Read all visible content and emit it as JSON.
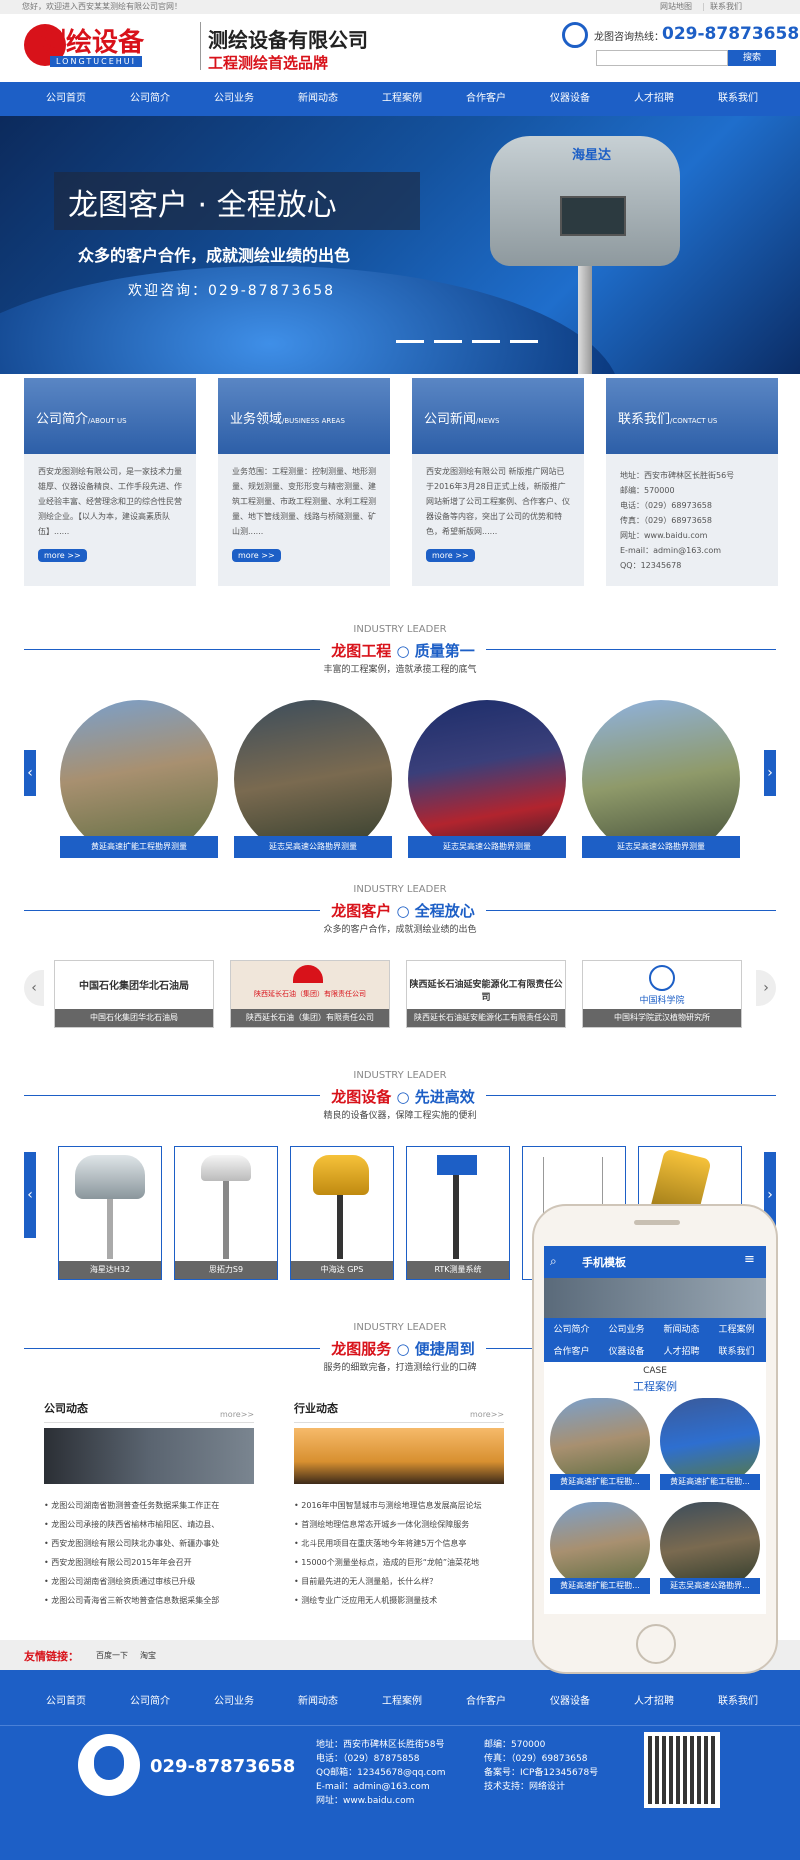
{
  "topbar": {
    "welcome": "您好，欢迎进入西安某某测绘有限公司官网！",
    "links": [
      "网站地图",
      "联系我们"
    ]
  },
  "header": {
    "logo_text": "测绘设备",
    "logo_sub": "LONGTUCEHUI",
    "company": "测绘设备有限公司",
    "slogan": "工程测绘首选品牌",
    "hotline_label": "龙图咨询热线：",
    "hotline": "029-87873658",
    "search_placeholder": "",
    "search_button": "搜索"
  },
  "nav": [
    "公司首页",
    "公司简介",
    "公司业务",
    "新闻动态",
    "工程案例",
    "合作客户",
    "仪器设备",
    "人才招聘",
    "联系我们"
  ],
  "banner": {
    "headline": "龙图客户 · 全程放心",
    "sub": "众多的客户合作，成就测绘业绩的出色",
    "consult": "欢迎咨询：029-87873658",
    "device_brand": "海星达"
  },
  "cards": [
    {
      "title": "公司简介",
      "en": "/ABOUT US",
      "text": "西安龙图测绘有限公司，是一家技术力量雄厚、仪器设备精良、工作手段先进、作业经验丰富、经营理念和卫的综合性民营测绘企业。【以人为本，建设高素质队伍】......",
      "more": "more >>"
    },
    {
      "title": "业务领域",
      "en": "/BUSINESS AREAS",
      "text": "业务范围：工程测量：控制测量、地形测量、规划测量、变形形变与精密测量、建筑工程测量、市政工程测量、水利工程测量、地下管线测量、线路与桥隧测量、矿山测......",
      "more": "more >>"
    },
    {
      "title": "公司新闻",
      "en": "/NEWS",
      "text": "西安龙图测绘有限公司 新版推广网站已于2016年3月28日正式上线，新版推广网站新增了公司工程案例、合作客户、仪器设备等内容，突出了公司的优势和特色，希望新版网......",
      "more": "more >>"
    },
    {
      "title": "联系我们",
      "en": "/CONTACT US",
      "lines": [
        "地址：西安市碑林区长胜街56号",
        "邮编：570000",
        "电话：（029）68973658",
        "传真：（029）68973658",
        "网址：www.baidu.com",
        "E-mail：admin@163.com",
        "QQ：12345678"
      ]
    }
  ],
  "sections": [
    {
      "en": "INDUSTRY LEADER",
      "title_a": "龙图工程",
      "title_b": "质量第一",
      "sub": "丰富的工程案例，造就承揽工程的底气"
    },
    {
      "en": "INDUSTRY LEADER",
      "title_a": "龙图客户",
      "title_b": "全程放心",
      "sub": "众多的客户合作，成就测绘业绩的出色"
    },
    {
      "en": "INDUSTRY LEADER",
      "title_a": "龙图设备",
      "title_b": "先进高效",
      "sub": "精良的设备仪器，保障工程实施的便利"
    },
    {
      "en": "INDUSTRY LEADER",
      "title_a": "龙图服务",
      "title_b": "便捷周到",
      "sub": "服务的细致完备，打造测绘行业的口碑"
    }
  ],
  "cases": [
    "黄延高速扩能工程勘界测量",
    "延志吴高速公路勘界测量",
    "延志吴高速公路勘界测量",
    "延志吴高速公路勘界测量"
  ],
  "clients": [
    {
      "logo": "中国石化集团华北石油局",
      "caption": "中国石化集团华北石油局"
    },
    {
      "logo": "陕西延长石油（集团）有限责任公司",
      "caption": "陕西延长石油（集团）有限责任公司"
    },
    {
      "logo": "陕西延长石油延安能源化工有限责任公司",
      "caption": "陕西延长石油延安能源化工有限责任公司"
    },
    {
      "logo": "中国科学院",
      "caption": "中国科学院武汉植物研究所"
    }
  ],
  "equipment": [
    "海星达H32",
    "思拓力S9",
    "中海达 GPS",
    "RTK测量系统",
    "",
    ""
  ],
  "news": {
    "company": {
      "title": "公司动态",
      "more": "more>>",
      "items": [
        "龙图公司湖南省勘测普查任务数据采集工作正在",
        "龙图公司承接的陕西省榆林市榆阳区、靖边县、",
        "西安龙图测绘有限公司陕北办事处、新疆办事处",
        "西安龙图测绘有限公司2015年年会召开",
        "龙图公司湖南省测绘资质通过审核已升级",
        "龙图公司青海省三新农地普查信息数据采集全部"
      ]
    },
    "industry": {
      "title": "行业动态",
      "more": "more>>",
      "items": [
        "2016年中国智慧城市与测绘地理信息发展高层论坛",
        "首测绘地理信息常态开城乡一体化测绘保障服务",
        "北斗民用项目在重庆落地今年将建5万个信息亭",
        "15000个测量坐标点，造成的巨形“龙帕”油菜花地",
        "目前最先进的无人测量船，长什么样？",
        "测绘专业广泛应用无人机摄影测量技术"
      ]
    }
  },
  "friends": {
    "label": "友情链接：",
    "links": [
      "百度一下",
      "淘宝"
    ]
  },
  "footer": {
    "nav": [
      "公司首页",
      "公司简介",
      "公司业务",
      "新闻动态",
      "工程案例",
      "合作客户",
      "仪器设备",
      "人才招聘",
      "联系我们"
    ],
    "phone": "029-87873658",
    "left": [
      "地址：西安市碑林区长胜街58号",
      "电话：（029）87875858",
      "QQ邮箱：12345678@qq.com",
      "E-mail：admin@163.com",
      "网址：www.baidu.com"
    ],
    "right": [
      "邮编：570000",
      "传真：（029）69873658",
      "备案号：ICP备12345678号",
      "技术支持：网络设计"
    ]
  },
  "mobile": {
    "title": "手机模板",
    "menu": [
      "公司简介",
      "公司业务",
      "新闻动态",
      "工程案例",
      "合作客户",
      "仪器设备",
      "人才招聘",
      "联系我们"
    ],
    "case_en": "CASE",
    "case_cn": "工程案例",
    "items": [
      "黄延高速扩能工程勘...",
      "黄延高速扩能工程勘...",
      "黄延高速扩能工程勘...",
      "延志吴高速公路勘界..."
    ]
  },
  "colors": {
    "brand_blue": "#1d5fc6",
    "accent_red": "#d8121a"
  }
}
